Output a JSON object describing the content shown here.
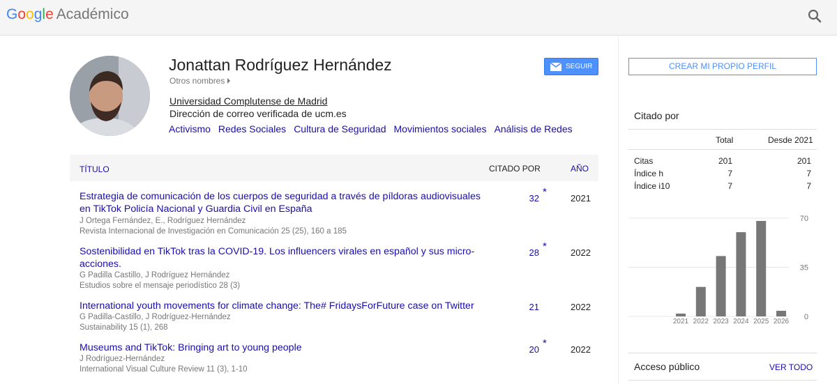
{
  "header": {
    "logo_letters": [
      "G",
      "o",
      "o",
      "g",
      "l",
      "e"
    ],
    "logo_product": "Académico",
    "search_icon": "search-icon"
  },
  "profile": {
    "name": "Jonattan Rodríguez Hernández",
    "other_names": "Otros nombres",
    "affiliation": "Universidad Complutense de Madrid",
    "email_verified": "Dirección de correo verificada de ucm.es",
    "interests": [
      "Activismo",
      "Redes Sociales",
      "Cultura de Seguridad",
      "Movimientos sociales",
      "Análisis de Redes"
    ],
    "follow_label": "SEGUIR",
    "follow_icon": "mail-icon"
  },
  "table": {
    "col_title": "TÍTULO",
    "col_cited": "CITADO POR",
    "col_year": "AÑO",
    "rows": [
      {
        "title": "Estrategia de comunicación de los cuerpos de seguridad a través de píldoras audiovisuales en TikTok Policía Nacional y Guardia Civil en España",
        "authors": "J Ortega Fernández, E., Rodríguez Hernández",
        "source": "Revista Internacional de Investigación en Comunicación 25 (25), 160 a 185",
        "cited": "32",
        "star": "*",
        "year": "2021"
      },
      {
        "title": "Sostenibilidad en TikTok tras la COVID-19. Los influencers virales en español y sus micro-acciones.",
        "authors": "G Padilla Castillo, J Rodríguez Hernández",
        "source": "Estudios sobre el mensaje periodístico 28 (3)",
        "cited": "28",
        "star": "*",
        "year": "2022"
      },
      {
        "title": "International youth movements for climate change: The# FridaysForFuture case on Twitter",
        "authors": "G Padilla-Castillo, J Rodríguez-Hernández",
        "source": "Sustainability 15 (1), 268",
        "cited": "21",
        "star": "",
        "year": "2022"
      },
      {
        "title": "Museums and TikTok: Bringing art to young people",
        "authors": "J Rodríguez-Hernández",
        "source": "International Visual Culture Review 11 (3), 1-10",
        "cited": "20",
        "star": "*",
        "year": "2022"
      }
    ]
  },
  "sidebar": {
    "create_profile": "CREAR MI PROPIO PERFIL",
    "cited_by_title": "Citado por",
    "col_total": "Total",
    "col_since": "Desde 2021",
    "metrics": [
      {
        "label": "Citas",
        "total": "201",
        "since": "201"
      },
      {
        "label": "Índice h",
        "total": "7",
        "since": "7"
      },
      {
        "label": "Índice i10",
        "total": "7",
        "since": "7"
      }
    ],
    "open_access_title": "Acceso público",
    "see_all": "VER TODO"
  },
  "chart_data": {
    "type": "bar",
    "categories": [
      "2021",
      "2022",
      "2023",
      "2024",
      "2025",
      "2026"
    ],
    "values": [
      2,
      21,
      43,
      60,
      68,
      4
    ],
    "ylim": [
      0,
      70
    ],
    "yticks": [
      "70",
      "35",
      "0"
    ],
    "grid": true,
    "bar_color": "#777777"
  }
}
